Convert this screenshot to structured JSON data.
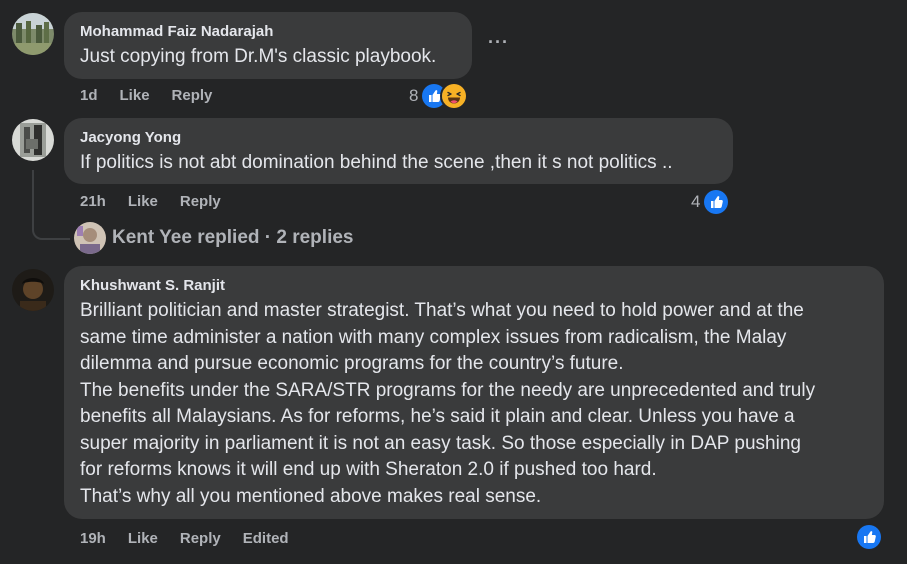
{
  "comments": [
    {
      "author": "Mohammad Faiz Nadarajah",
      "text": "Just copying from Dr.M's classic playbook.",
      "time": "1d",
      "like_label": "Like",
      "reply_label": "Reply",
      "reaction_count": "8",
      "reactions": [
        "like-icon",
        "haha-icon"
      ],
      "more_label": "···"
    },
    {
      "author": "Jacyong Yong",
      "text": "If politics is not abt domination behind the scene ,then it s not politics ..",
      "time": "21h",
      "like_label": "Like",
      "reply_label": "Reply",
      "reaction_count": "4",
      "reactions": [
        "like-icon"
      ],
      "replies_summary": "Kent Yee replied · 2 replies"
    },
    {
      "author": "Khushwant S. Ranjit",
      "lines": [
        "Brilliant politician and master strategist. That’s what you need to hold power and at the",
        "same time administer a nation with many complex issues from radicalism, the Malay",
        "dilemma and pursue economic programs for the country’s future.",
        "The benefits under the SARA/STR programs for the needy are unprecedented and truly",
        "benefits all Malaysians. As for reforms, he’s said it plain and clear. Unless you have a",
        "super majority in parliament it is not an easy task. So those especially in DAP pushing",
        "for reforms knows it will end up with Sheraton 2.0 if pushed too hard.",
        "That’s why all you mentioned above makes real sense."
      ],
      "time": "19h",
      "like_label": "Like",
      "reply_label": "Reply",
      "edited_label": "Edited",
      "reactions": [
        "like-icon"
      ]
    }
  ],
  "colors": {
    "background": "#242526",
    "bubble": "#3a3b3c",
    "text": "#e4e6eb",
    "secondary": "#b0b3b8",
    "like_blue": "#1877f2",
    "haha_yellow": "#f7b125"
  }
}
